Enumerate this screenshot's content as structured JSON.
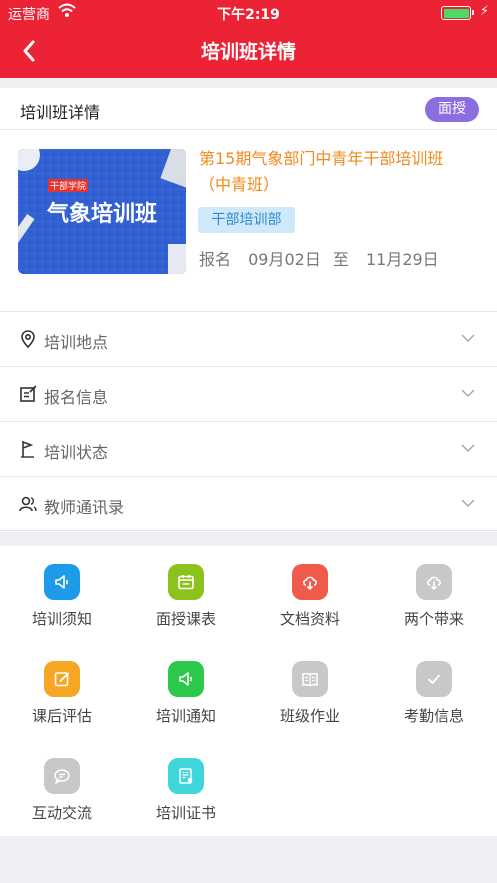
{
  "status_bar": {
    "carrier": "运营商",
    "time": "下午2:19",
    "battery_level": 1.0,
    "battery_color": "#4cd964"
  },
  "nav": {
    "title": "培训班详情",
    "back_icon": "chevron-left-icon"
  },
  "card": {
    "header_label": "培训班详情",
    "mode_tag": "面授",
    "mode_tag_color": "#8b6de0",
    "thumbnail": {
      "badge": "干部学院",
      "text": "气象培训班"
    },
    "course_title": "第15期气象部门中青年干部培训班（中青班）",
    "department_tag": "干部培训部",
    "enroll": {
      "label": "报名",
      "start": "09月02日",
      "sep": "至",
      "end": "11月29日"
    }
  },
  "sections": [
    {
      "label": "培训地点",
      "icon": "location-pin-icon"
    },
    {
      "label": "报名信息",
      "icon": "edit-note-icon"
    },
    {
      "label": "培训状态",
      "icon": "flag-icon"
    },
    {
      "label": "教师通讯录",
      "icon": "contacts-icon"
    }
  ],
  "functions": [
    {
      "label": "培训须知",
      "icon": "megaphone-icon",
      "color": "#1e9be8"
    },
    {
      "label": "面授课表",
      "icon": "calendar-icon",
      "color": "#8cc21c"
    },
    {
      "label": "文档资料",
      "icon": "cloud-download-icon",
      "color": "#f05a4b"
    },
    {
      "label": "两个带来",
      "icon": "cloud-download-icon",
      "color": "#c8c8c8"
    },
    {
      "label": "课后评估",
      "icon": "edit-icon",
      "color": "#f5a623"
    },
    {
      "label": "培训通知",
      "icon": "megaphone-icon",
      "color": "#2cc84a"
    },
    {
      "label": "班级作业",
      "icon": "book-icon",
      "color": "#c8c8c8"
    },
    {
      "label": "考勤信息",
      "icon": "check-icon",
      "color": "#c8c8c8"
    },
    {
      "label": "互动交流",
      "icon": "chat-icon",
      "color": "#c8c8c8"
    },
    {
      "label": "培训证书",
      "icon": "certificate-icon",
      "color": "#3ed6d9"
    }
  ]
}
